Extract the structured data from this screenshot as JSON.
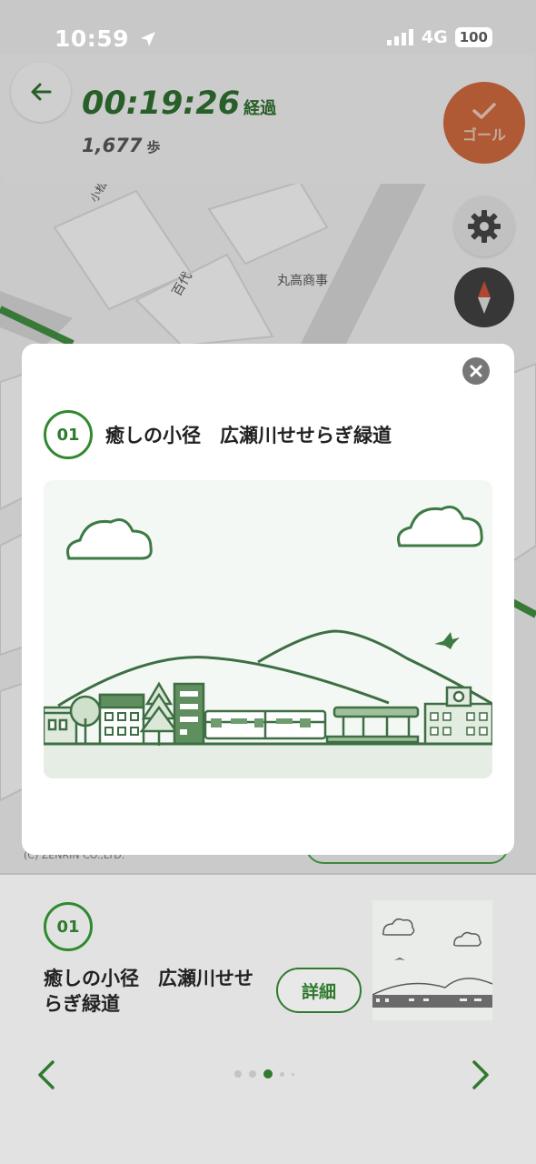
{
  "status_bar": {
    "time": "10:59",
    "network": "4G",
    "battery": "100"
  },
  "header": {
    "elapsed_time": "00:19:26",
    "elapsed_label": "経過",
    "steps_count": "1,677",
    "steps_unit": "歩",
    "goal_label": "ゴール"
  },
  "map": {
    "labels": [
      "丸高商事",
      "百代",
      "小松"
    ],
    "copyright": "(C) ZENRIN CO.,LTD."
  },
  "modal": {
    "number": "01",
    "title": "癒しの小径　広瀬川せせらぎ緑道"
  },
  "card": {
    "number": "01",
    "title": "癒しの小径　広瀬川せせらぎ緑道",
    "detail_label": "詳細",
    "page_count": 5,
    "active_page": 3
  },
  "colors": {
    "accent_green": "#2f7a2f",
    "goal_orange": "#c8663d"
  }
}
